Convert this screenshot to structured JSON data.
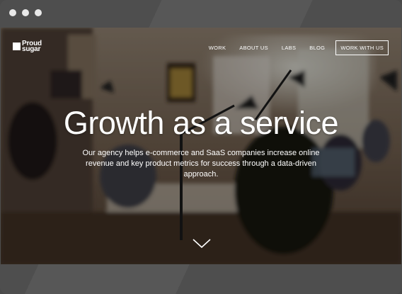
{
  "nav": {
    "logo_line1": "Proud",
    "logo_line2": "sugar",
    "items": [
      {
        "label": "WORK"
      },
      {
        "label": "ABOUT US"
      },
      {
        "label": "LABS"
      },
      {
        "label": "BLOG"
      }
    ],
    "cta_label": "WORK WITH US"
  },
  "hero": {
    "title": "Growth as a service",
    "subtitle": "Our agency helps e-commerce and SaaS companies increase online revenue and key product metrics for success through a data-driven approach."
  },
  "icons": {
    "scroll": "chevron-down-icon",
    "logo": "logo-mark-icon"
  },
  "colors": {
    "frame": "#4e4e4e",
    "text": "#ffffff"
  }
}
